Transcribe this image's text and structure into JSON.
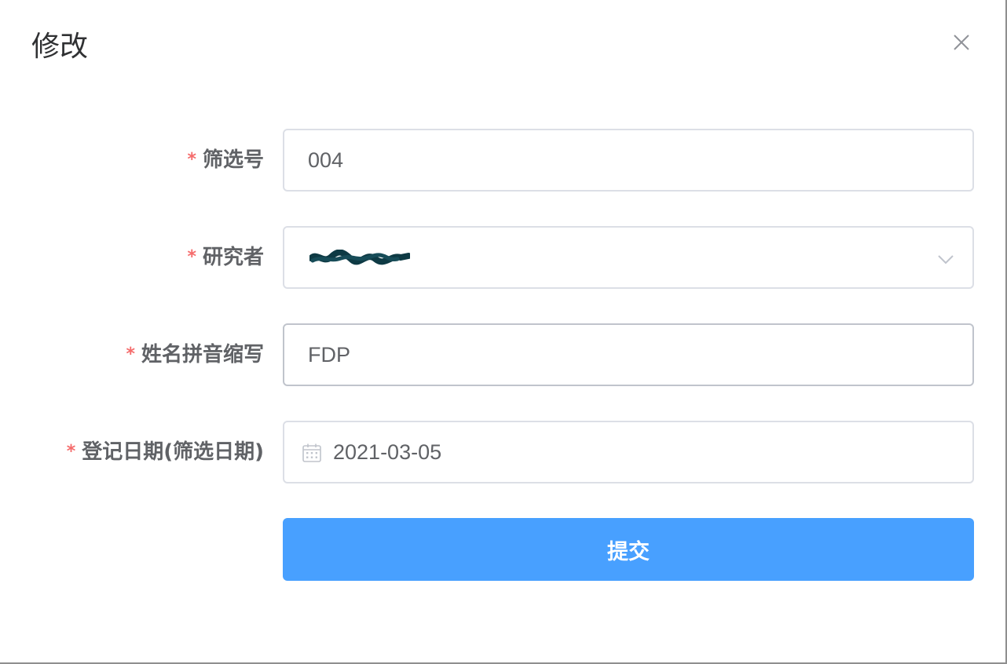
{
  "dialog": {
    "title": "修改"
  },
  "form": {
    "fields": [
      {
        "required_mark": "*",
        "label": "筛选号",
        "value": "004"
      },
      {
        "required_mark": "*",
        "label": "研究者",
        "value": ""
      },
      {
        "required_mark": "*",
        "label": "姓名拼音缩写",
        "value": "FDP"
      },
      {
        "required_mark": "*",
        "label": "登记日期(筛选日期)",
        "value": "2021-03-05"
      }
    ],
    "submit_label": "提交"
  },
  "colors": {
    "primary": "#48a0ff",
    "required": "#f56c6c",
    "label": "#606266",
    "border": "#dcdfe6"
  },
  "icons": {
    "close": "close-icon",
    "select_arrow": "chevron-down-icon",
    "date": "calendar-icon"
  }
}
